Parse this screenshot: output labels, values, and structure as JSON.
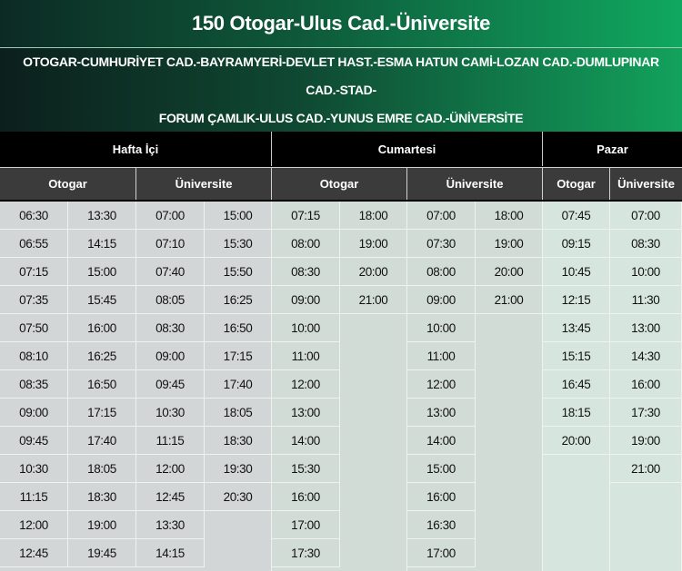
{
  "title": "150 Otogar-Ulus Cad.-Üniversite",
  "route": {
    "line1": "OTOGAR-CUMHURİYET CAD.-BAYRAMYERİ-DEVLET HAST.-ESMA HATUN CAMİ-LOZAN CAD.-DUMLUPINAR CAD.-STAD-",
    "line2": "FORUM ÇAMLIK-ULUS CAD.-YUNUS EMRE CAD.-ÜNİVERSİTE"
  },
  "days": {
    "weekday": "Hafta İçi",
    "saturday": "Cumartesi",
    "sunday": "Pazar"
  },
  "stops": {
    "otogar": "Otogar",
    "universite": "Üniversite"
  },
  "columns": [
    [
      "06:30",
      "06:55",
      "07:15",
      "07:35",
      "07:50",
      "08:10",
      "08:35",
      "09:00",
      "09:45",
      "10:30",
      "11:15",
      "12:00",
      "12:45"
    ],
    [
      "13:30",
      "14:15",
      "15:00",
      "15:45",
      "16:00",
      "16:25",
      "16:50",
      "17:15",
      "17:40",
      "18:05",
      "18:30",
      "19:00",
      "19:45"
    ],
    [
      "07:00",
      "07:10",
      "07:40",
      "08:05",
      "08:30",
      "09:00",
      "09:45",
      "10:30",
      "11:15",
      "12:00",
      "12:45",
      "13:30",
      "14:15"
    ],
    [
      "15:00",
      "15:30",
      "15:50",
      "16:25",
      "16:50",
      "17:15",
      "17:40",
      "18:05",
      "18:30",
      "19:30",
      "20:30"
    ],
    [
      "07:15",
      "08:00",
      "08:30",
      "09:00",
      "10:00",
      "11:00",
      "12:00",
      "13:00",
      "14:00",
      "15:30",
      "16:00",
      "17:00",
      "17:30"
    ],
    [
      "18:00",
      "19:00",
      "20:00",
      "21:00"
    ],
    [
      "07:00",
      "07:30",
      "08:00",
      "09:00",
      "10:00",
      "11:00",
      "12:00",
      "13:00",
      "14:00",
      "15:00",
      "16:00",
      "16:30",
      "17:00"
    ],
    [
      "18:00",
      "19:00",
      "20:00",
      "21:00"
    ],
    [
      "07:45",
      "09:15",
      "10:45",
      "12:15",
      "13:45",
      "15:15",
      "16:45",
      "18:15",
      "20:00"
    ],
    [
      "07:00",
      "08:30",
      "10:00",
      "11:30",
      "13:00",
      "14:30",
      "16:00",
      "17:30",
      "19:00",
      "21:00"
    ]
  ],
  "colors": {
    "weekday_cells": "#d2d6d6",
    "saturday_cells": "#d2dcd7",
    "sunday_cells": "#d6e6de",
    "header_bg": "#3b3b3b",
    "accent_green": "#10a860"
  }
}
